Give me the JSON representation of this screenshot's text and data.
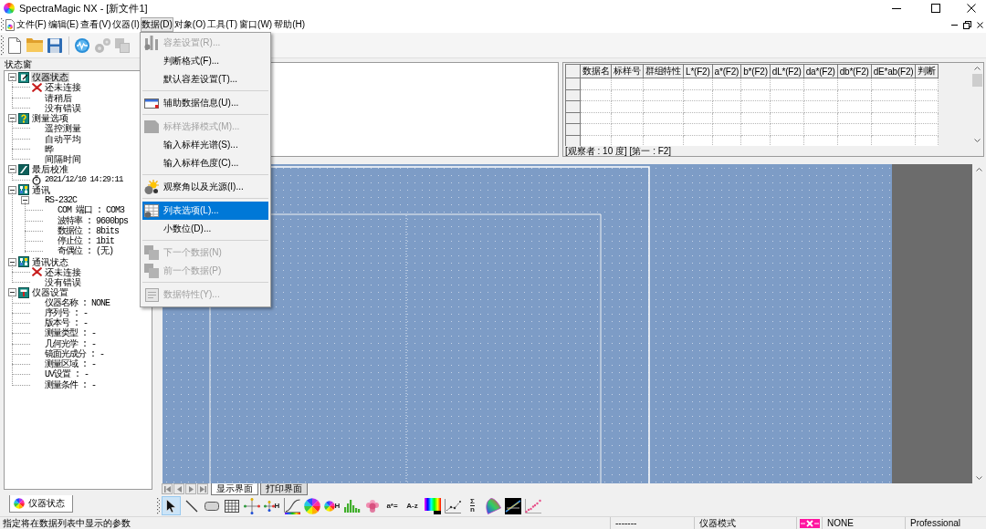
{
  "window": {
    "title": "SpectraMagic NX - [新文件1]"
  },
  "menu": [
    {
      "label": "文件(F)",
      "selected": false
    },
    {
      "label": "编辑(E)",
      "selected": false
    },
    {
      "label": "查看(V)",
      "selected": false
    },
    {
      "label": "仪器(I)",
      "selected": false
    },
    {
      "label": "数据(D)",
      "selected": true
    },
    {
      "label": "对象(O)",
      "selected": false
    },
    {
      "label": "工具(T)",
      "selected": false
    },
    {
      "label": "窗口(W)",
      "selected": false
    },
    {
      "label": "帮助(H)",
      "selected": false
    }
  ],
  "toolbar": [
    {
      "disabled": false
    },
    {
      "disabled": false
    },
    {
      "disabled": false
    },
    {
      "disabled": false
    },
    {
      "disabled": true
    },
    {
      "disabled": true
    }
  ],
  "dropdown": [
    {
      "kind": "command",
      "label": "容差设置(R)...",
      "disabled": true,
      "selected": false
    },
    {
      "kind": "command",
      "label": "判断格式(F)...",
      "disabled": false,
      "selected": false
    },
    {
      "kind": "command",
      "label": "默认容差设置(T)...",
      "disabled": false,
      "selected": false
    },
    {
      "kind": "separator"
    },
    {
      "kind": "command",
      "label": "辅助数据信息(U)...",
      "disabled": false,
      "selected": false
    },
    {
      "kind": "separator"
    },
    {
      "kind": "command",
      "label": "标样选择模式(M)...",
      "disabled": true,
      "selected": false
    },
    {
      "kind": "command",
      "label": "输入标样光谱(S)...",
      "disabled": false,
      "selected": false
    },
    {
      "kind": "command",
      "label": "输入标样色度(C)...",
      "disabled": false,
      "selected": false
    },
    {
      "kind": "separator"
    },
    {
      "kind": "command",
      "label": "观察角以及光源(I)...",
      "disabled": false,
      "selected": false
    },
    {
      "kind": "separator"
    },
    {
      "kind": "command",
      "label": "列表选项(L)...",
      "disabled": false,
      "selected": true
    },
    {
      "kind": "command",
      "label": "小数位(D)...",
      "disabled": false,
      "selected": false
    },
    {
      "kind": "separator"
    },
    {
      "kind": "command",
      "label": "下一个数据(N)",
      "disabled": true,
      "selected": false
    },
    {
      "kind": "command",
      "label": "前一个数据(P)",
      "disabled": true,
      "selected": false
    },
    {
      "kind": "separator"
    },
    {
      "kind": "command",
      "label": "数据特性(Y)...",
      "disabled": true,
      "selected": false
    }
  ],
  "status_pane": {
    "title": "状态窗",
    "tree": [
      {
        "label": "仪器状态",
        "kind": "group",
        "selected": true,
        "expanded": true,
        "children": [
          {
            "label": "还未连接",
            "kind": "error",
            "selected": false
          },
          {
            "label": "请稍后",
            "kind": "text",
            "selected": false
          },
          {
            "label": "没有错误",
            "kind": "text",
            "selected": false
          }
        ]
      },
      {
        "label": "测量选项",
        "kind": "group",
        "selected": false,
        "expanded": true,
        "children": [
          {
            "label": "遥控测量",
            "kind": "text",
            "selected": false
          },
          {
            "label": "自动平均",
            "kind": "text",
            "selected": false
          },
          {
            "label": "晔",
            "kind": "text",
            "selected": false
          },
          {
            "label": "间隔时间",
            "kind": "text",
            "selected": false
          }
        ]
      },
      {
        "label": "最后校准",
        "kind": "group",
        "selected": false,
        "expanded": true,
        "children": [
          {
            "label": "2021/12/10 14:29:11",
            "kind": "time",
            "selected": false
          }
        ]
      },
      {
        "label": "通讯",
        "kind": "group",
        "selected": false,
        "expanded": true,
        "children": [
          {
            "label": "RS-232C",
            "kind": "value",
            "selected": false,
            "expanded": true,
            "children": [
              {
                "label": "COM 端口 : COM3",
                "kind": "value",
                "selected": false
              },
              {
                "label": "波特率 : 9600bps",
                "kind": "value",
                "selected": false
              },
              {
                "label": "数据位 : 8bits",
                "kind": "value",
                "selected": false
              },
              {
                "label": "停止位 : 1bit",
                "kind": "value",
                "selected": false
              },
              {
                "label": "奇偶位 : (无)",
                "kind": "value",
                "selected": false
              }
            ]
          }
        ]
      },
      {
        "label": "通讯状态",
        "kind": "group",
        "selected": false,
        "expanded": true,
        "children": [
          {
            "label": "还未连接",
            "kind": "error",
            "selected": false
          },
          {
            "label": "没有错误",
            "kind": "text",
            "selected": false
          }
        ]
      },
      {
        "label": "仪器设置",
        "kind": "group",
        "selected": false,
        "expanded": true,
        "children": [
          {
            "label": "仪器名称 : NONE",
            "kind": "value",
            "selected": false
          },
          {
            "label": "序列号 : -",
            "kind": "value",
            "selected": false
          },
          {
            "label": "版本号 : -",
            "kind": "value",
            "selected": false
          },
          {
            "label": "测量类型 : -",
            "kind": "value",
            "selected": false
          },
          {
            "label": "几何光学 : -",
            "kind": "value",
            "selected": false
          },
          {
            "label": "镜面光成分 : -",
            "kind": "value",
            "selected": false
          },
          {
            "label": "测量区域 : -",
            "kind": "value",
            "selected": false
          },
          {
            "label": "UV设置 : -",
            "kind": "value",
            "selected": false
          },
          {
            "label": "测量条件 : -",
            "kind": "value",
            "selected": false
          }
        ]
      }
    ],
    "tabs": [
      {
        "label": "仪器状态",
        "selected": true
      }
    ]
  },
  "table": {
    "columns": [
      "数据名",
      "标样号",
      "群组特性",
      "L*(F2)",
      "a*(F2)",
      "b*(F2)",
      "dL*(F2)",
      "da*(F2)",
      "db*(F2)",
      "dE*ab(F2)",
      "判断"
    ],
    "caption": "[观察者 : 10 度] [第一 : F2]"
  },
  "view_tabs": [
    {
      "label": "显示界面",
      "selected": true
    },
    {
      "label": "打印界面",
      "selected": false
    }
  ],
  "drawing_tools": [
    {
      "selected": true
    },
    {
      "selected": false
    },
    {
      "selected": false
    },
    {
      "selected": false
    },
    {
      "selected": false
    },
    {
      "selected": false,
      "text": [
        "H"
      ]
    },
    {
      "selected": false
    },
    {
      "selected": false
    },
    {
      "selected": false,
      "text": [
        "H"
      ]
    },
    {
      "selected": false
    },
    {
      "selected": false
    },
    {
      "selected": false,
      "text": [
        "a*="
      ]
    },
    {
      "selected": false,
      "text": [
        "A-z"
      ]
    },
    {
      "selected": false
    },
    {
      "selected": false
    },
    {
      "selected": false,
      "text": [
        "Σ",
        "n"
      ]
    },
    {
      "selected": false
    },
    {
      "selected": false
    },
    {
      "selected": false
    }
  ],
  "status_bar": {
    "message": "指定将在数据列表中显示的参数",
    "panes": [
      {
        "kind": "text",
        "text": "-------"
      },
      {
        "kind": "text",
        "text": "仪器模式"
      },
      {
        "kind": "indicator"
      },
      {
        "kind": "text",
        "text": "NONE"
      },
      {
        "kind": "text",
        "text": "Professional"
      }
    ]
  }
}
